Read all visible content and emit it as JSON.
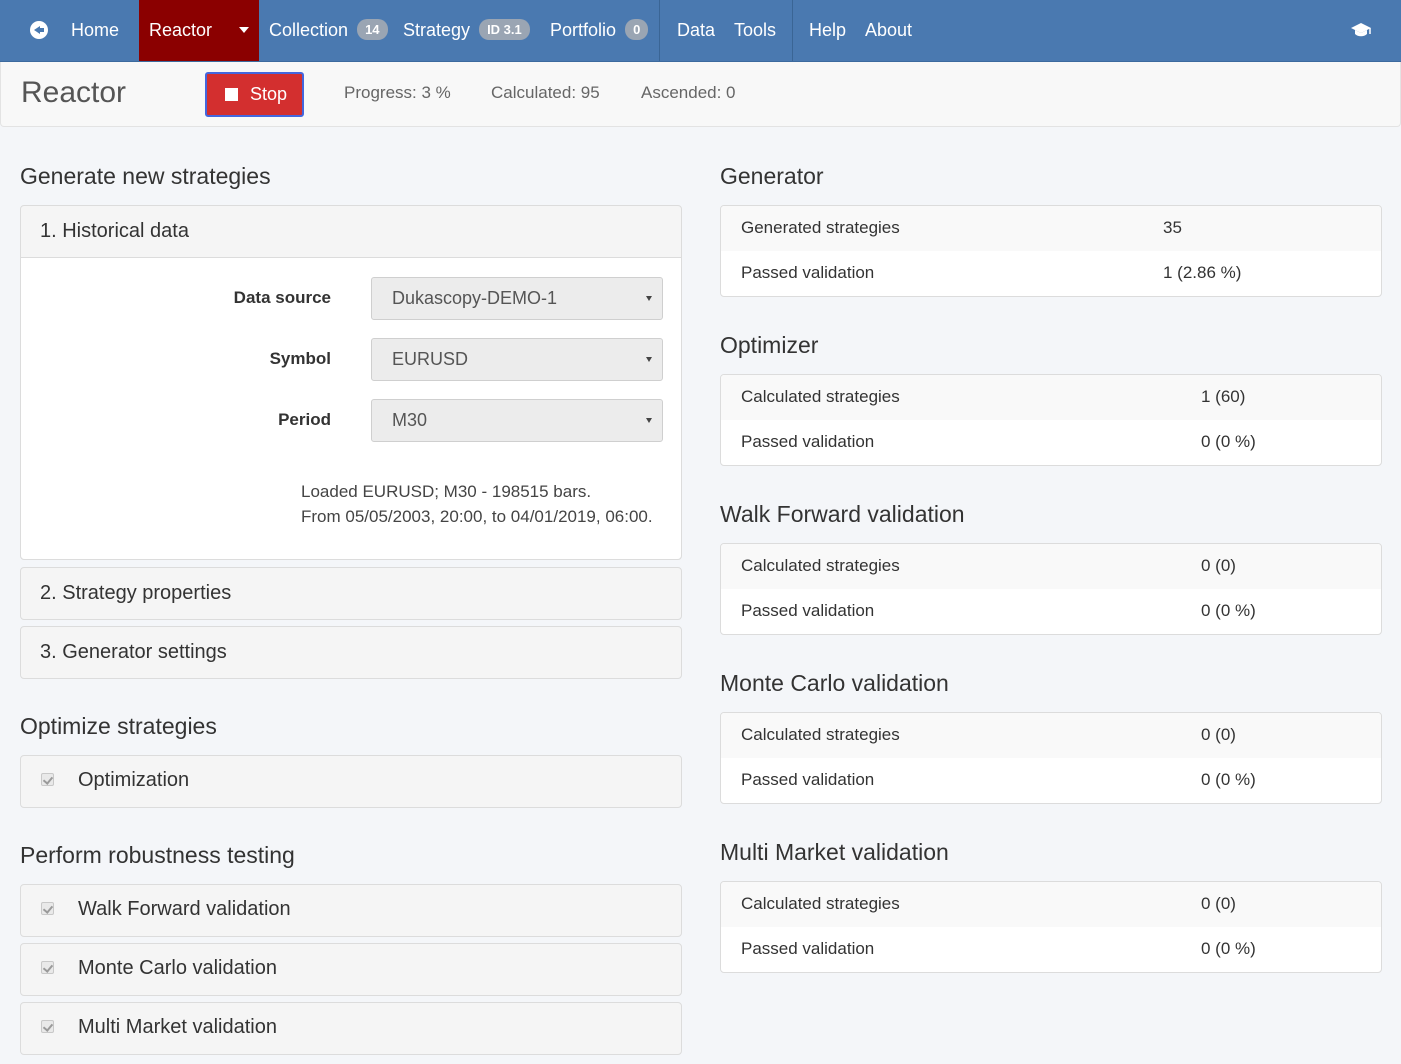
{
  "nav": {
    "home": "Home",
    "reactor": "Reactor",
    "collection": "Collection",
    "collection_count": "14",
    "strategy": "Strategy",
    "strategy_id": "ID 3.1",
    "portfolio": "Portfolio",
    "portfolio_count": "0",
    "data": "Data",
    "tools": "Tools",
    "help": "Help",
    "about": "About"
  },
  "header": {
    "title": "Reactor",
    "stop_label": "Stop",
    "progress": "Progress: 3 %",
    "calculated": "Calculated: 95",
    "ascended": "Ascended: 0"
  },
  "left": {
    "generate_title": "Generate new strategies",
    "historical_title": "1. Historical data",
    "data_source_label": "Data source",
    "data_source_value": "Dukascopy-DEMO-1",
    "symbol_label": "Symbol",
    "symbol_value": "EURUSD",
    "period_label": "Period",
    "period_value": "M30",
    "loaded_line1": "Loaded EURUSD; M30 - 198515 bars.",
    "loaded_line2": "From 05/05/2003, 20:00, to 04/01/2019, 06:00.",
    "strategy_props": "2. Strategy properties",
    "generator_settings": "3. Generator settings",
    "optimize_title": "Optimize strategies",
    "optimization": "Optimization",
    "robustness_title": "Perform robustness testing",
    "walk_forward": "Walk Forward validation",
    "monte_carlo": "Monte Carlo validation",
    "multi_market": "Multi Market validation"
  },
  "right": {
    "generator": {
      "title": "Generator",
      "row1_label": "Generated strategies",
      "row1_value": "35",
      "row2_label": "Passed validation",
      "row2_value": "1 (2.86 %)"
    },
    "optimizer": {
      "title": "Optimizer",
      "row1_label": "Calculated strategies",
      "row1_value": "1 (60)",
      "row2_label": "Passed validation",
      "row2_value": "0 (0 %)"
    },
    "walk_forward": {
      "title": "Walk Forward validation",
      "row1_label": "Calculated strategies",
      "row1_value": "0 (0)",
      "row2_label": "Passed validation",
      "row2_value": "0 (0 %)"
    },
    "monte_carlo": {
      "title": "Monte Carlo validation",
      "row1_label": "Calculated strategies",
      "row1_value": "0 (0)",
      "row2_label": "Passed validation",
      "row2_value": "0 (0 %)"
    },
    "multi_market": {
      "title": "Multi Market validation",
      "row1_label": "Calculated strategies",
      "row1_value": "0 (0)",
      "row2_label": "Passed validation",
      "row2_value": "0 (0 %)"
    }
  },
  "colors": {
    "navbar": "#4a79b0",
    "active_tab": "#8b0000",
    "stop_button": "#d32f2f"
  }
}
